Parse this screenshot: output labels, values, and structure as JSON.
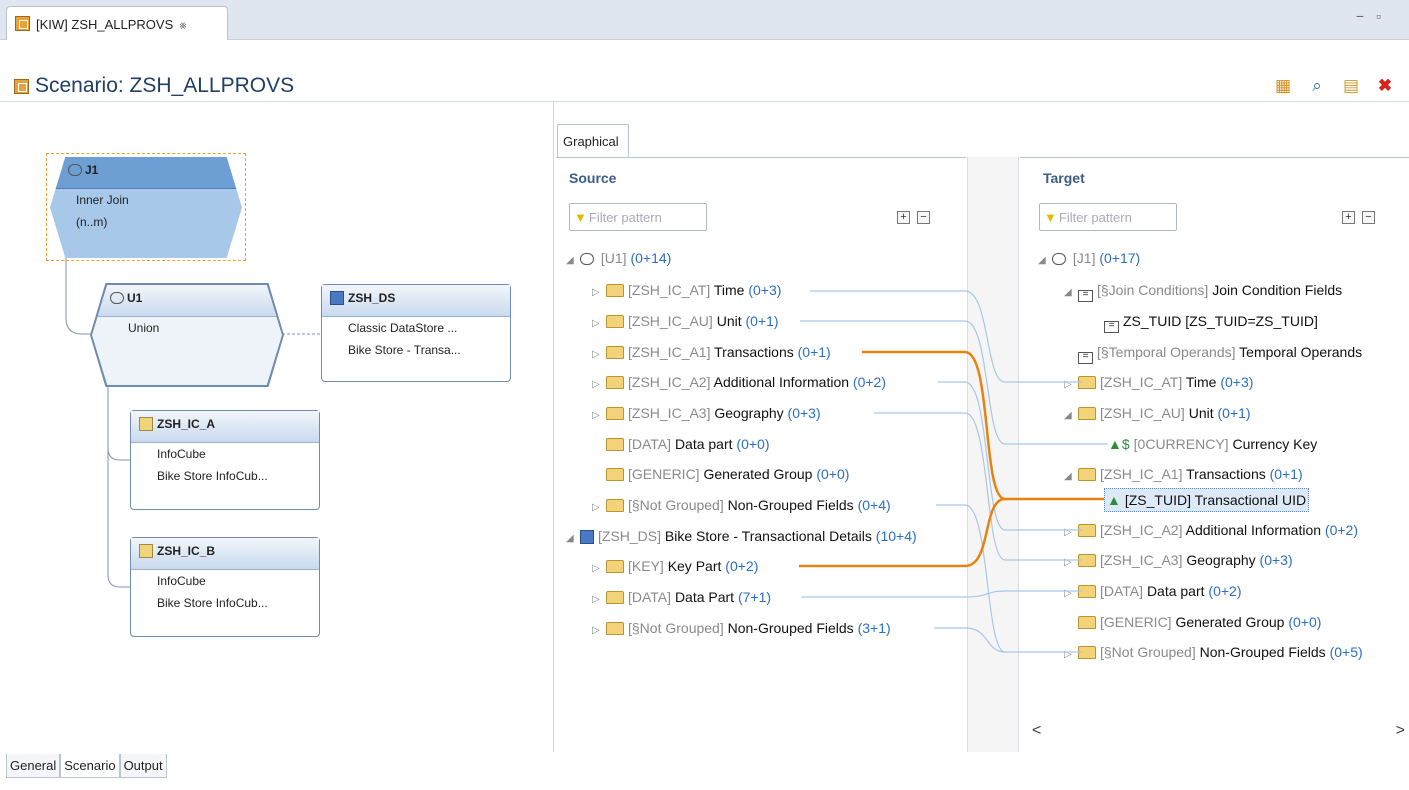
{
  "editor_tab": {
    "label": "[KIW] ZSH_ALLPROVS",
    "close": "⨳"
  },
  "window_controls": {
    "minimize": "−",
    "maximize": "▫"
  },
  "title": "Scenario: ZSH_ALLPROVS",
  "toolbar": {
    "icons": [
      "table-icon",
      "search-icon",
      "document-icon",
      "close-red-icon"
    ]
  },
  "nodes": {
    "j1": {
      "name": "J1",
      "line1": "Inner Join",
      "line2": "(n..m)"
    },
    "u1": {
      "name": "U1",
      "line1": "Union"
    },
    "zsh_ds": {
      "name": "ZSH_DS",
      "line1": "Classic DataStore ...",
      "line2": "Bike Store - Transa..."
    },
    "zsh_ic_a": {
      "name": "ZSH_IC_A",
      "line1": "InfoCube",
      "line2": "Bike Store InfoCub..."
    },
    "zsh_ic_b": {
      "name": "ZSH_IC_B",
      "line1": "InfoCube",
      "line2": "Bike Store InfoCub..."
    }
  },
  "graphical_tab": "Graphical",
  "source": {
    "title": "Source",
    "filter_placeholder": "Filter pattern",
    "rows": [
      {
        "key": "[U1]",
        "name": "",
        "count": "(0+14)"
      },
      {
        "key": "[ZSH_IC_AT]",
        "name": "Time",
        "count": "(0+3)"
      },
      {
        "key": "[ZSH_IC_AU]",
        "name": "Unit",
        "count": "(0+1)"
      },
      {
        "key": "[ZSH_IC_A1]",
        "name": "Transactions",
        "count": "(0+1)"
      },
      {
        "key": "[ZSH_IC_A2]",
        "name": "Additional Information",
        "count": "(0+2)"
      },
      {
        "key": "[ZSH_IC_A3]",
        "name": "Geography",
        "count": "(0+3)"
      },
      {
        "key": "[DATA]",
        "name": "Data part",
        "count": "(0+0)"
      },
      {
        "key": "[GENERIC]",
        "name": "Generated Group",
        "count": "(0+0)"
      },
      {
        "key": "[§Not Grouped]",
        "name": "Non-Grouped Fields",
        "count": "(0+4)"
      },
      {
        "key": "[ZSH_DS]",
        "name": "Bike Store - Transactional Details",
        "count": "(10+4)"
      },
      {
        "key": "[KEY]",
        "name": "Key Part",
        "count": "(0+2)"
      },
      {
        "key": "[DATA]",
        "name": "Data Part",
        "count": "(7+1)"
      },
      {
        "key": "[§Not Grouped]",
        "name": "Non-Grouped Fields",
        "count": "(3+1)"
      }
    ]
  },
  "target": {
    "title": "Target",
    "filter_placeholder": "Filter pattern",
    "rows": [
      {
        "key": "[J1]",
        "name": "",
        "count": "(0+17)"
      },
      {
        "key": "[§Join Conditions]",
        "name": "Join Condition Fields",
        "count": ""
      },
      {
        "key": "",
        "name": "ZS_TUID [ZS_TUID=ZS_TUID]",
        "count": ""
      },
      {
        "key": "[§Temporal Operands]",
        "name": "Temporal Operands",
        "count": ""
      },
      {
        "key": "[ZSH_IC_AT]",
        "name": "Time",
        "count": "(0+3)"
      },
      {
        "key": "[ZSH_IC_AU]",
        "name": "Unit",
        "count": "(0+1)"
      },
      {
        "key": "[0CURRENCY]",
        "name": "Currency Key",
        "count": ""
      },
      {
        "key": "[ZSH_IC_A1]",
        "name": "Transactions",
        "count": "(0+1)"
      },
      {
        "key": "[ZS_TUID]",
        "name": "Transactional UID",
        "count": ""
      },
      {
        "key": "[ZSH_IC_A2]",
        "name": "Additional Information",
        "count": "(0+2)"
      },
      {
        "key": "[ZSH_IC_A3]",
        "name": "Geography",
        "count": "(0+3)"
      },
      {
        "key": "[DATA]",
        "name": "Data part",
        "count": "(0+2)"
      },
      {
        "key": "[GENERIC]",
        "name": "Generated Group",
        "count": "(0+0)"
      },
      {
        "key": "[§Not Grouped]",
        "name": "Non-Grouped Fields",
        "count": "(0+5)"
      }
    ]
  },
  "scroll": {
    "left": "<",
    "right": ">"
  },
  "bottom_tabs": [
    "General",
    "Scenario",
    "Output"
  ],
  "colors": {
    "link": "#a9c6e6",
    "link_active": "#e8820e",
    "accent": "#2a6fc1"
  }
}
